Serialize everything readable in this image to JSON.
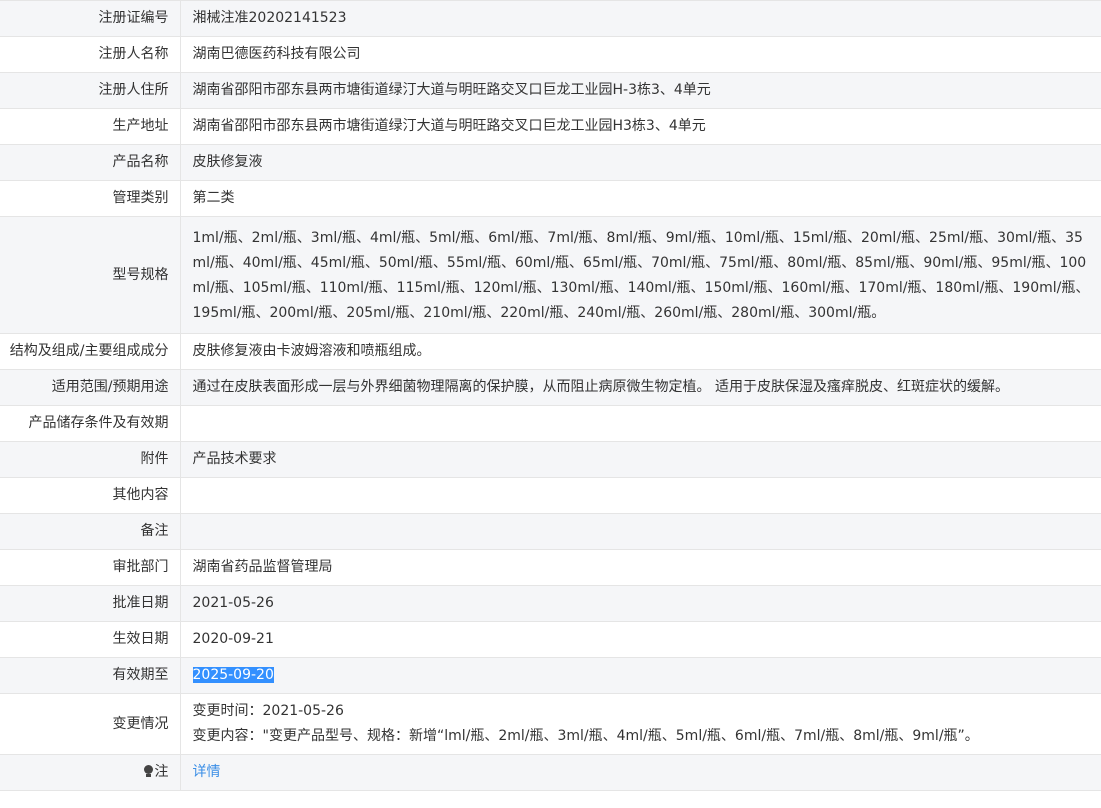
{
  "fields": [
    {
      "label": "注册证编号",
      "value": "湘械注准20202141523"
    },
    {
      "label": "注册人名称",
      "value": "湖南巴德医药科技有限公司"
    },
    {
      "label": "注册人住所",
      "value": "湖南省邵阳市邵东县两市塘街道绿汀大道与明旺路交叉口巨龙工业园H-3栋3、4单元"
    },
    {
      "label": "生产地址",
      "value": "湖南省邵阳市邵东县两市塘街道绿汀大道与明旺路交叉口巨龙工业园H3栋3、4单元"
    },
    {
      "label": "产品名称",
      "value": "皮肤修复液"
    },
    {
      "label": "管理类别",
      "value": "第二类"
    },
    {
      "label": "型号规格",
      "value": "1ml/瓶、2ml/瓶、3ml/瓶、4ml/瓶、5ml/瓶、6ml/瓶、7ml/瓶、8ml/瓶、9ml/瓶、10ml/瓶、15ml/瓶、20ml/瓶、25ml/瓶、30ml/瓶、35ml/瓶、40ml/瓶、45ml/瓶、50ml/瓶、55ml/瓶、60ml/瓶、65ml/瓶、70ml/瓶、75ml/瓶、80ml/瓶、85ml/瓶、90ml/瓶、95ml/瓶、100ml/瓶、105ml/瓶、110ml/瓶、115ml/瓶、120ml/瓶、130ml/瓶、140ml/瓶、150ml/瓶、160ml/瓶、170ml/瓶、180ml/瓶、190ml/瓶、195ml/瓶、200ml/瓶、205ml/瓶、210ml/瓶、220ml/瓶、240ml/瓶、260ml/瓶、280ml/瓶、300ml/瓶。"
    },
    {
      "label": "结构及组成/主要组成成分",
      "value": "皮肤修复液由卡波姆溶液和喷瓶组成。"
    },
    {
      "label": "适用范围/预期用途",
      "value": "通过在皮肤表面形成一层与外界细菌物理隔离的保护膜，从而阻止病原微生物定植。 适用于皮肤保湿及瘙痒脱皮、红斑症状的缓解。"
    },
    {
      "label": "产品储存条件及有效期",
      "value": ""
    },
    {
      "label": "附件",
      "value": "产品技术要求"
    },
    {
      "label": "其他内容",
      "value": ""
    },
    {
      "label": "备注",
      "value": ""
    },
    {
      "label": "审批部门",
      "value": "湖南省药品监督管理局"
    },
    {
      "label": "批准日期",
      "value": "2021-05-26"
    },
    {
      "label": "生效日期",
      "value": "2020-09-21"
    },
    {
      "label": "有效期至",
      "value": "2025-09-20"
    }
  ],
  "change": {
    "label": "变更情况",
    "time_line": "变更时间：2021-05-26",
    "content_line": "变更内容：\"变更产品型号、规格：新增“lml/瓶、2ml/瓶、3ml/瓶、4ml/瓶、5ml/瓶、6ml/瓶、7ml/瓶、8ml/瓶、9ml/瓶”。"
  },
  "note": {
    "label": "注",
    "icon": "lightbulb-icon",
    "link_text": "详情",
    "link_color": "#3a8ee6"
  },
  "selection": {
    "field": "有效期至",
    "highlight_color": "#3390ff"
  }
}
